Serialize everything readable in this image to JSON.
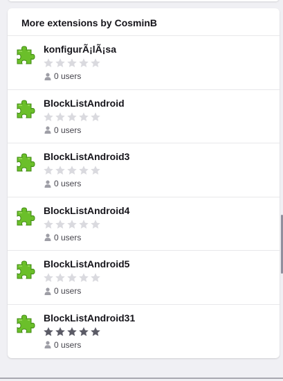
{
  "section": {
    "title": "More extensions by CosminB"
  },
  "colors": {
    "puzzle_green": "#6bbf2a",
    "star_empty": "#dadadf",
    "star_filled": "#5b5b66"
  },
  "extensions": [
    {
      "name": "konfigurÃ¡lÃ¡sa",
      "rating": 0,
      "users": "0 users"
    },
    {
      "name": "BlockListAndroid",
      "rating": 0,
      "users": "0 users"
    },
    {
      "name": "BlockListAndroid3",
      "rating": 0,
      "users": "0 users"
    },
    {
      "name": "BlockListAndroid4",
      "rating": 0,
      "users": "0 users"
    },
    {
      "name": "BlockListAndroid5",
      "rating": 0,
      "users": "0 users"
    },
    {
      "name": "BlockListAndroid31",
      "rating": 5,
      "users": "0 users"
    }
  ],
  "icons": {
    "extension": "puzzle-piece-icon",
    "rating": "star-icon",
    "users": "user-icon"
  }
}
